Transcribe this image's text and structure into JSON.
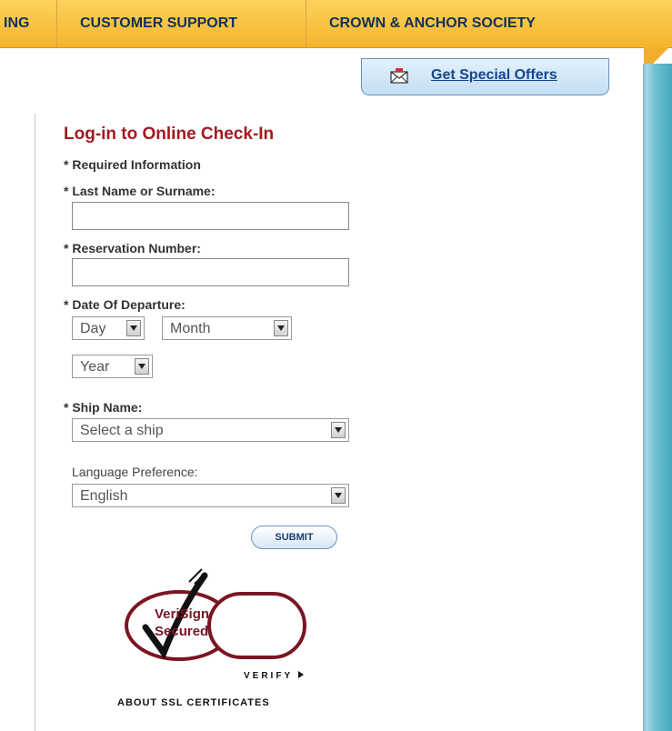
{
  "nav": {
    "items": [
      {
        "label": "ING"
      },
      {
        "label": "CUSTOMER SUPPORT"
      },
      {
        "label": "CROWN & ANCHOR SOCIETY"
      }
    ]
  },
  "offers": {
    "label": "Get Special Offers",
    "icon": "envelope-icon"
  },
  "form": {
    "title": "Log-in to Online Check-In",
    "required_note": "* Required Information",
    "last_name_label": "* Last Name or Surname:",
    "last_name_value": "",
    "reservation_label": "* Reservation Number:",
    "reservation_value": "",
    "departure_label": "* Date Of Departure:",
    "day_value": "Day",
    "month_value": "Month",
    "year_value": "Year",
    "ship_label": "* Ship Name:",
    "ship_value": "Select a ship",
    "language_label": "Language Preference:",
    "language_value": "English",
    "submit_label": "SUBMIT"
  },
  "seal": {
    "line1": "VeriSign",
    "line2": "Secured",
    "verify": "VERIFY",
    "about": "ABOUT SSL CERTIFICATES"
  },
  "colors": {
    "nav_bg": "#f3b52c",
    "nav_text": "#12305a",
    "title_red": "#a11a1f",
    "link_blue": "#17468f"
  }
}
